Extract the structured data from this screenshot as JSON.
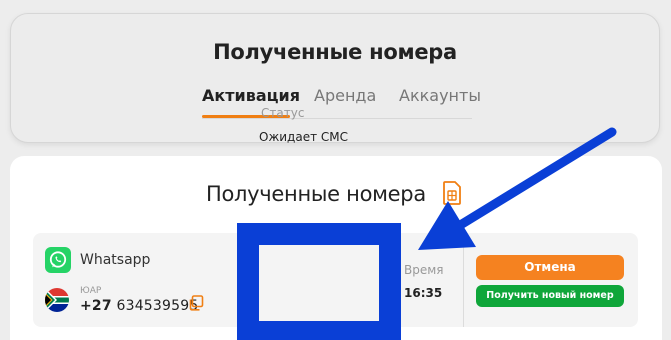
{
  "header": {
    "title": "Полученные номера",
    "tabs": [
      {
        "label": "Активация",
        "active": true
      },
      {
        "label": "Аренда",
        "active": false
      },
      {
        "label": "Аккаунты",
        "active": false
      }
    ]
  },
  "section": {
    "title": "Полученные номера",
    "icon": "sim-card-icon"
  },
  "order": {
    "service": "Whatsapp",
    "service_icon": "whatsapp-icon",
    "country": "ЮАР",
    "country_flag": "south-africa-flag",
    "phone_prefix": "+27",
    "phone_number": "634539595",
    "status_label": "Статус",
    "status_value": "Ожидает СМС",
    "time_label": "Время",
    "time_value": "16:35",
    "cancel_label": "Отмена",
    "new_number_label": "Получить новый номер"
  },
  "colors": {
    "accent_orange": "#f58220",
    "action_green": "#0fa63a",
    "annotation_blue": "#0a3fd6"
  }
}
